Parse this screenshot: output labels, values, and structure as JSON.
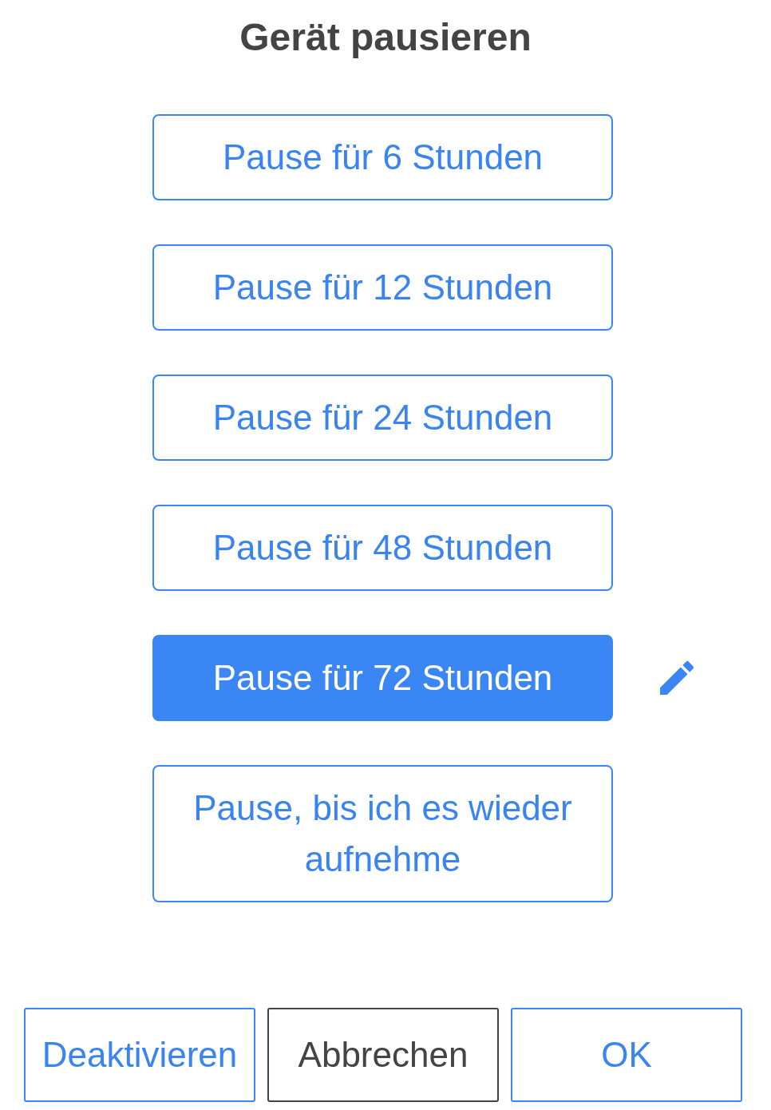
{
  "title": "Gerät pausieren",
  "options": [
    {
      "label": "Pause für 6 Stunden",
      "selected": false
    },
    {
      "label": "Pause für 12 Stunden",
      "selected": false
    },
    {
      "label": "Pause für 24 Stunden",
      "selected": false
    },
    {
      "label": "Pause für 48 Stunden",
      "selected": false
    },
    {
      "label": "Pause für 72 Stunden",
      "selected": true
    },
    {
      "label": "Pause, bis ich es wieder aufnehme",
      "selected": false
    }
  ],
  "buttons": [
    {
      "label": "Deaktivieren",
      "kind": "accent"
    },
    {
      "label": "Abbrechen",
      "kind": "neutral"
    },
    {
      "label": "OK",
      "kind": "accent"
    }
  ]
}
